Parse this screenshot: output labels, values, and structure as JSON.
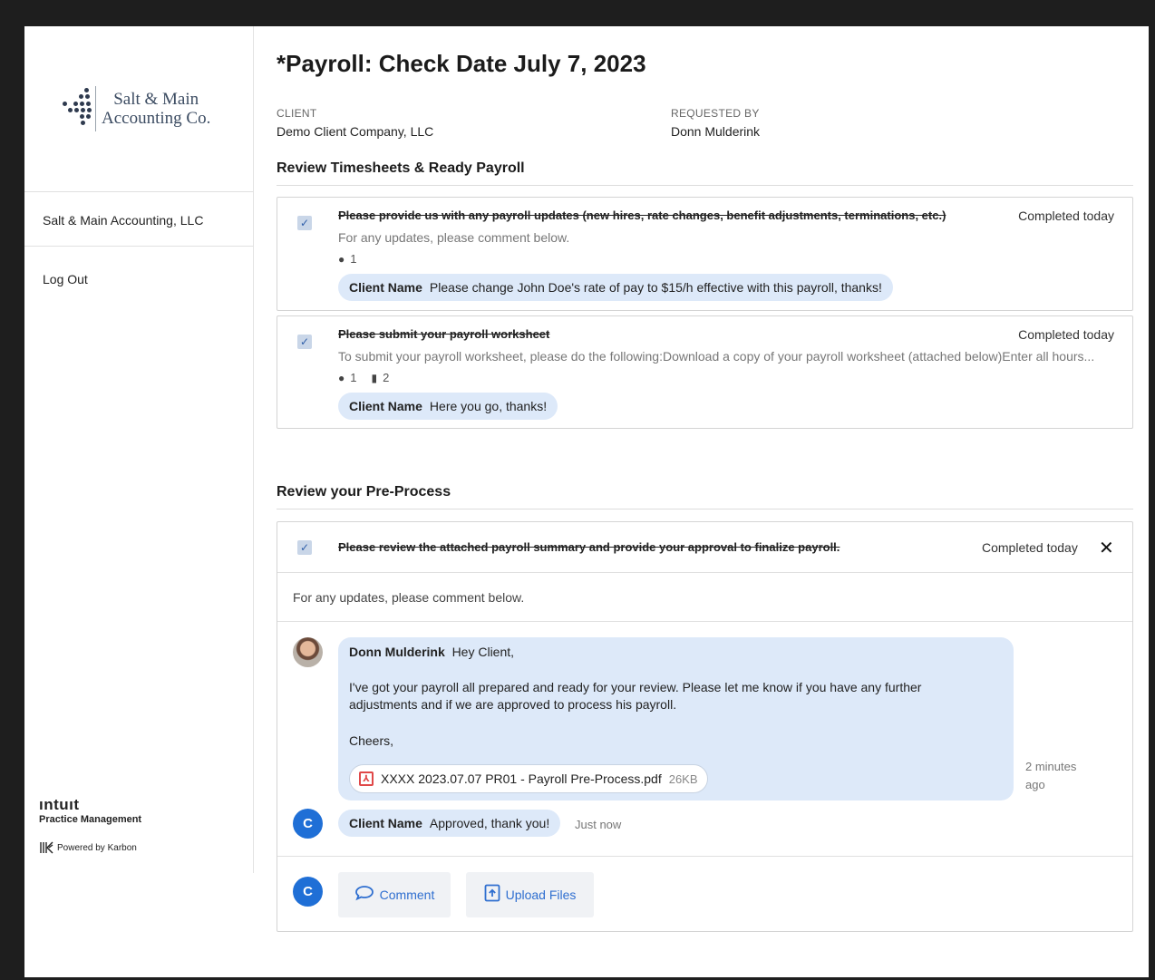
{
  "sidebar": {
    "logo_line1": "Salt & Main",
    "logo_line2": "Accounting Co.",
    "org_name": "Salt & Main Accounting, LLC",
    "logout": "Log Out",
    "brand_name": "ıntuıt",
    "brand_sub": "Practice Management",
    "powered_by": "Powered by Karbon"
  },
  "header": {
    "title": "*Payroll: Check Date July 7, 2023",
    "client_label": "CLIENT",
    "client_value": "Demo Client Company, LLC",
    "requested_label": "REQUESTED BY",
    "requested_value": "Donn Mulderink"
  },
  "section1": {
    "title": "Review Timesheets & Ready Payroll",
    "tasks": [
      {
        "title": "Please provide us with any payroll updates (new hires, rate changes, benefit adjustments, terminations, etc.)",
        "status": "Completed today",
        "description": "For any updates, please comment below.",
        "comment_count": "1",
        "bubble_author": "Client Name",
        "bubble_text": "Please change John Doe's rate of pay to $15/h effective with this payroll, thanks!"
      },
      {
        "title": "Please submit your payroll worksheet",
        "status": "Completed today",
        "description": "To submit your payroll worksheet, please do the following:Download a copy of your payroll worksheet (attached below)Enter all hours...",
        "comment_count": "1",
        "file_count": "2",
        "bubble_author": "Client Name",
        "bubble_text": "Here you go, thanks!"
      }
    ]
  },
  "section2": {
    "title": "Review your Pre-Process",
    "task": {
      "title": "Please review the attached payroll summary and provide your approval to finalize payroll.",
      "status": "Completed today",
      "description": "For any updates, please comment below.",
      "message": {
        "author": "Donn Mulderink",
        "greeting": "Hey Client,",
        "line1": "I've got your payroll all prepared and ready for your review.  Please let me know if you have any further",
        "line2": "adjustments and if we are approved to process his payroll.",
        "signoff": "Cheers,",
        "attachment_name": "XXXX 2023.07.07 PR01 - Payroll Pre-Process.pdf",
        "attachment_size": "26KB",
        "time_line1": "2 minutes",
        "time_line2": "ago"
      },
      "reply": {
        "avatar": "C",
        "author": "Client Name",
        "text": "Approved, thank you!",
        "time": "Just now"
      },
      "composer_avatar": "C",
      "comment_button": "Comment",
      "upload_button": "Upload Files"
    }
  },
  "colors": {
    "accent": "#2f6fd0",
    "bubble": "#dde9f9",
    "avatar": "#1f6fd6"
  }
}
